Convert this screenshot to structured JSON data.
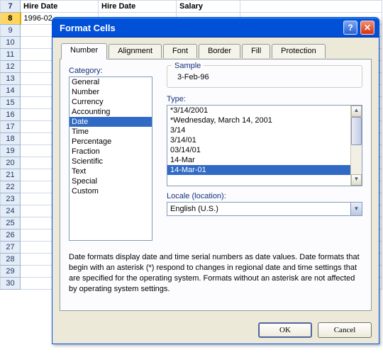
{
  "sheet": {
    "header": {
      "c1": "Hire Date",
      "c2": "Hire Date",
      "c3": "Salary"
    },
    "row8_col1": "1996-02",
    "rownums": [
      "7",
      "8",
      "9",
      "10",
      "11",
      "12",
      "13",
      "14",
      "15",
      "16",
      "17",
      "18",
      "19",
      "20",
      "21",
      "22",
      "23",
      "24",
      "25",
      "26",
      "27",
      "28",
      "29",
      "30"
    ]
  },
  "dialog": {
    "title": "Format Cells",
    "tabs": {
      "number": "Number",
      "alignment": "Alignment",
      "font": "Font",
      "border": "Border",
      "fill": "Fill",
      "protection": "Protection"
    },
    "category_label": "Category:",
    "categories": [
      "General",
      "Number",
      "Currency",
      "Accounting",
      "Date",
      "Time",
      "Percentage",
      "Fraction",
      "Scientific",
      "Text",
      "Special",
      "Custom"
    ],
    "category_selected": "Date",
    "sample_label": "Sample",
    "sample_value": "3-Feb-96",
    "type_label": "Type:",
    "types": [
      "*3/14/2001",
      "*Wednesday, March 14, 2001",
      "3/14",
      "3/14/01",
      "03/14/01",
      "14-Mar",
      "14-Mar-01"
    ],
    "type_selected": "14-Mar-01",
    "locale_label": "Locale (location):",
    "locale_value": "English (U.S.)",
    "description": "Date formats display date and time serial numbers as date values.  Date formats that begin with an asterisk (*) respond to changes in regional date and time settings that are specified for the operating system. Formats without an asterisk are not affected by operating system settings.",
    "ok": "OK",
    "cancel": "Cancel"
  }
}
